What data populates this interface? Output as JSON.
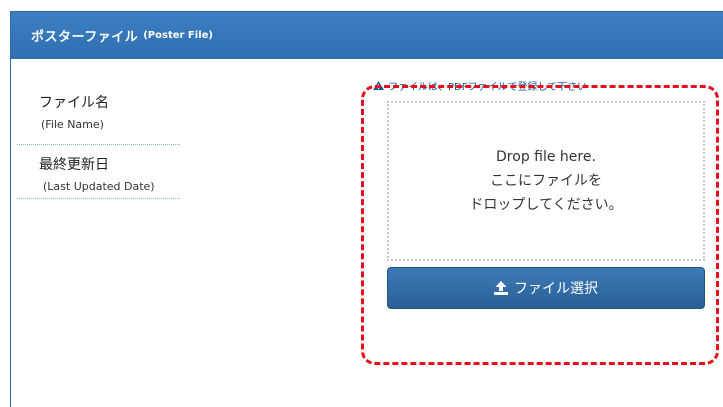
{
  "panel": {
    "title": "ポスターファイル",
    "title_en": "(Poster File)"
  },
  "fields": {
    "file_name": {
      "label": "ファイル名",
      "sub": "(File Name)"
    },
    "last_updated": {
      "label": "最終更新日",
      "sub": "(Last Updated Date)"
    }
  },
  "upload": {
    "note": "ファイルは、PDFファイルで登録して下さい",
    "drop_line1": "Drop file here.",
    "drop_line2": "ここにファイルを",
    "drop_line3": "ドロップしてください。",
    "button_label": "ファイル選択"
  },
  "icons": {
    "note": "warning-icon",
    "button": "upload-icon"
  },
  "colors": {
    "header": "#3577bb",
    "button": "#336ca6",
    "highlight_outline": "#e3101b"
  }
}
